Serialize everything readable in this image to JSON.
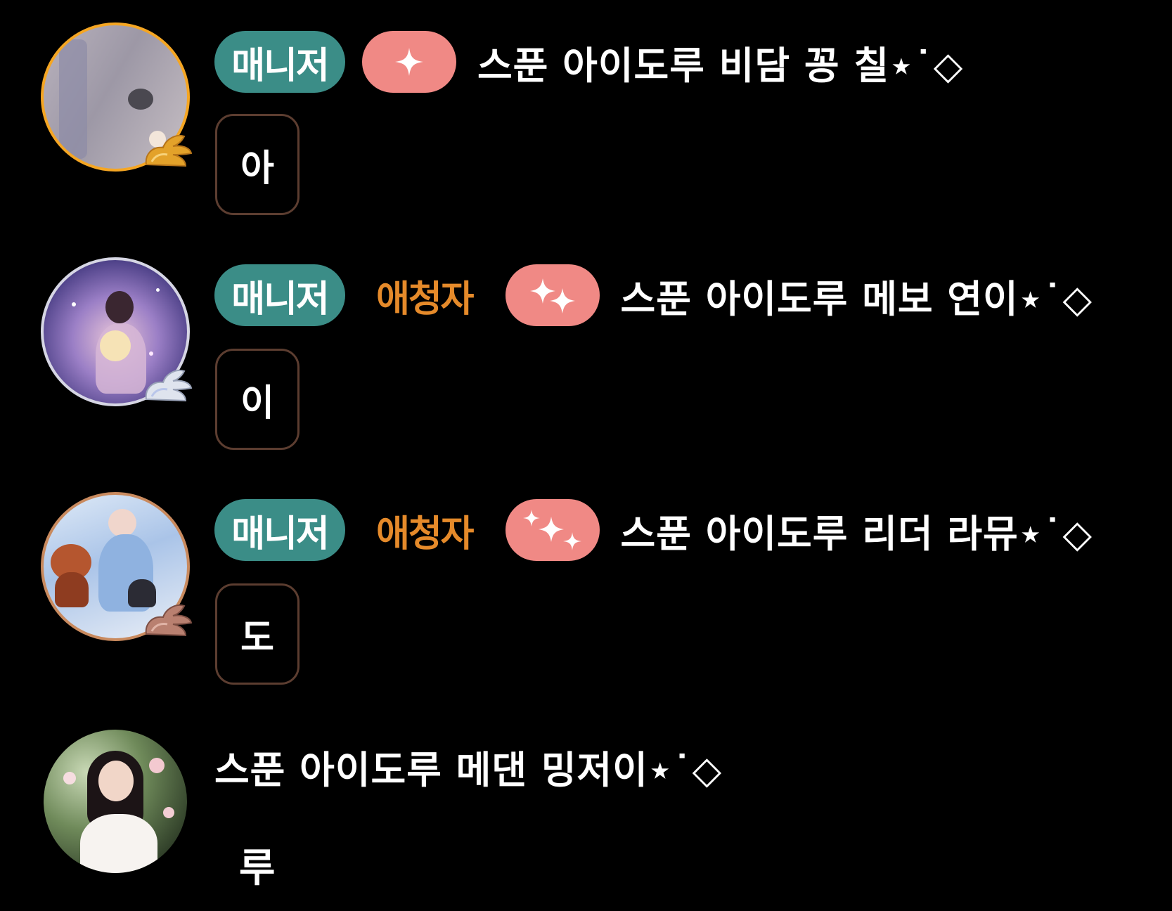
{
  "messages": [
    {
      "avatar_ring_color": "#f5a623",
      "badge": "매니저",
      "role": "",
      "sparkle_count": 1,
      "nickname": "스푼 아이도루 비담 꽁 칠⋆˙◇",
      "text": "아"
    },
    {
      "avatar_ring_color": "#d6d6e4",
      "badge": "매니저",
      "role": "애청자",
      "sparkle_count": 2,
      "nickname": "스푼 아이도루 메보 연이⋆˙◇",
      "text": "이"
    },
    {
      "avatar_ring_color": "#c98a5e",
      "badge": "매니저",
      "role": "애청자",
      "sparkle_count": 3,
      "nickname": "스푼 아이도루 리더 라뮤⋆˙◇",
      "text": "도"
    },
    {
      "avatar_ring_color": "#000000",
      "nickname": "스푼 아이도루 메댄 밍저이⋆˙◇",
      "text": "루"
    }
  ],
  "colors": {
    "background": "#000000",
    "manager_badge": "#3b8d87",
    "fan_role": "#e58a2a",
    "sparkle_badge": "#f08985",
    "bubble_border": "#5c3d30"
  }
}
